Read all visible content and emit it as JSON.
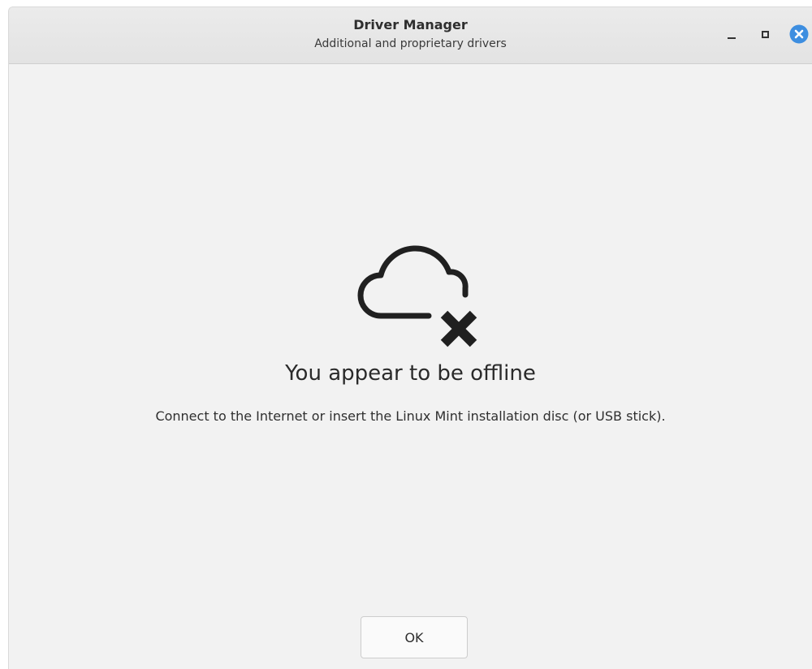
{
  "window": {
    "title": "Driver Manager",
    "subtitle": "Additional and proprietary drivers",
    "controls": {
      "minimize_icon": "minimize-icon",
      "maximize_icon": "maximize-icon",
      "close_icon": "close-icon"
    },
    "accent_color": "#3d8ee0"
  },
  "main": {
    "status_icon": "cloud-offline-icon",
    "heading": "You appear to be offline",
    "message": "Connect to the Internet or insert the Linux Mint installation disc (or USB stick).",
    "ok_label": "OK"
  }
}
